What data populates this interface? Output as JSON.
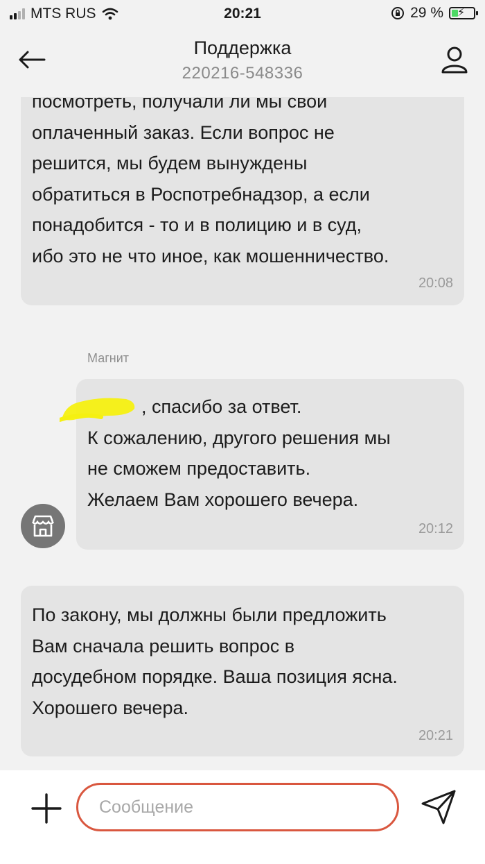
{
  "status_bar": {
    "carrier": "MTS RUS",
    "time": "20:21",
    "battery_text": "29 %",
    "battery_level": 0.29
  },
  "header": {
    "title": "Поддержка",
    "subtitle": "220216-548336"
  },
  "messages": [
    {
      "text": "посмотреть, получали ли мы свой\nоплаченный заказ. Если вопрос не\nрешится, мы будем вынуждены\nобратиться в Роспотребнадзор, а если\nпонадобится - то и в полицию и в суд,\nибо это не что иное, как мошенничество.",
      "time": "20:08"
    },
    {
      "sender": "Магнит",
      "text": ", спасибо за ответ.\nК сожалению, другого решения мы\nне сможем предоставить.\nЖелаем Вам хорошего вечера.",
      "time": "20:12"
    },
    {
      "text": "По закону, мы должны были предложить\nВам сначала решить вопрос в\nдосудебном порядке. Ваша позиция ясна.\nХорошего вечера.",
      "time": "20:21"
    }
  ],
  "composer": {
    "placeholder": "Сообщение",
    "value": ""
  },
  "icons": {
    "back": "arrow-left-icon",
    "profile": "person-icon",
    "store": "store-icon",
    "plus": "plus-icon",
    "send": "send-icon",
    "wifi": "wifi-icon",
    "lock": "rotation-lock-icon"
  },
  "colors": {
    "accent": "#d9573f",
    "bubble": "#e4e4e4",
    "background": "#f2f2f2",
    "battery_fill": "#4cd964",
    "highlight": "#f5f011"
  }
}
